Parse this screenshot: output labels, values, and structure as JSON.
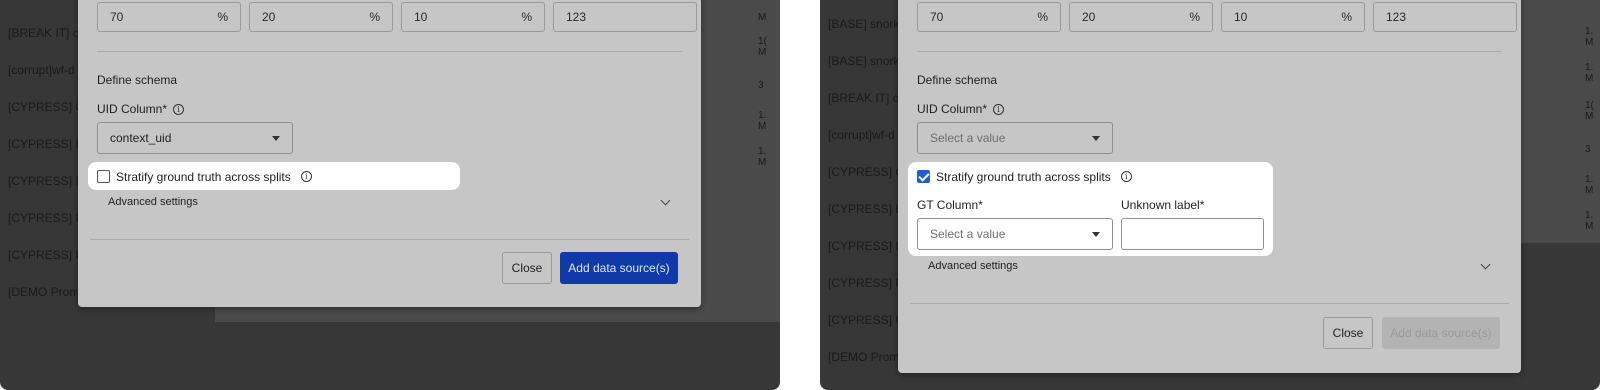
{
  "left": {
    "bg_items": [
      "[BREAK IT] co",
      "[corrupt]wf-d",
      "[CYPRESS] C",
      "[CYPRESS] H",
      "[CYPRESS] IM",
      "[CYPRESS] PI",
      "[CYPRESS] U",
      "[DEMO Promp"
    ],
    "bg_right": [
      "M",
      "1(\nM",
      "3",
      "1.\nM",
      "1.\nM"
    ],
    "splits": [
      {
        "value": "70",
        "suffix": "%"
      },
      {
        "value": "20",
        "suffix": "%"
      },
      {
        "value": "10",
        "suffix": "%"
      },
      {
        "value": "123",
        "suffix": ""
      }
    ],
    "define_schema": "Define schema",
    "uid_label": "UID Column*",
    "uid_value": "context_uid",
    "stratify_label": "Stratify ground truth across splits",
    "advanced": "Advanced settings",
    "close": "Close",
    "add": "Add data source(s)"
  },
  "right": {
    "bg_items": [
      "[BASE] snorke",
      "[BASE] snorke",
      "[BREAK IT] co",
      "[corrupt]wf-d",
      "[CYPRESS] C",
      "[CYPRESS] H",
      "[CYPRESS] IM",
      "[CYPRESS] PI",
      "[CYPRESS] U",
      "[DEMO Promp"
    ],
    "bg_right": [
      "1.\nM",
      "1.\nM",
      "1(\nM",
      "3",
      "1.\nM",
      "1.\nM"
    ],
    "splits": [
      {
        "value": "70",
        "suffix": "%"
      },
      {
        "value": "20",
        "suffix": "%"
      },
      {
        "value": "10",
        "suffix": "%"
      },
      {
        "value": "123",
        "suffix": ""
      }
    ],
    "define_schema": "Define schema",
    "uid_label": "UID Column*",
    "uid_placeholder": "Select a value",
    "stratify_label": "Stratify ground truth across splits",
    "gt_label": "GT Column*",
    "gt_placeholder": "Select a value",
    "unknown_label": "Unknown label*",
    "advanced": "Advanced settings",
    "close": "Close",
    "add": "Add data source(s)"
  },
  "colors": {
    "primary": "#0f3aa8",
    "checkbox_checked": "#1f5fd6",
    "overlay": "#373737"
  }
}
